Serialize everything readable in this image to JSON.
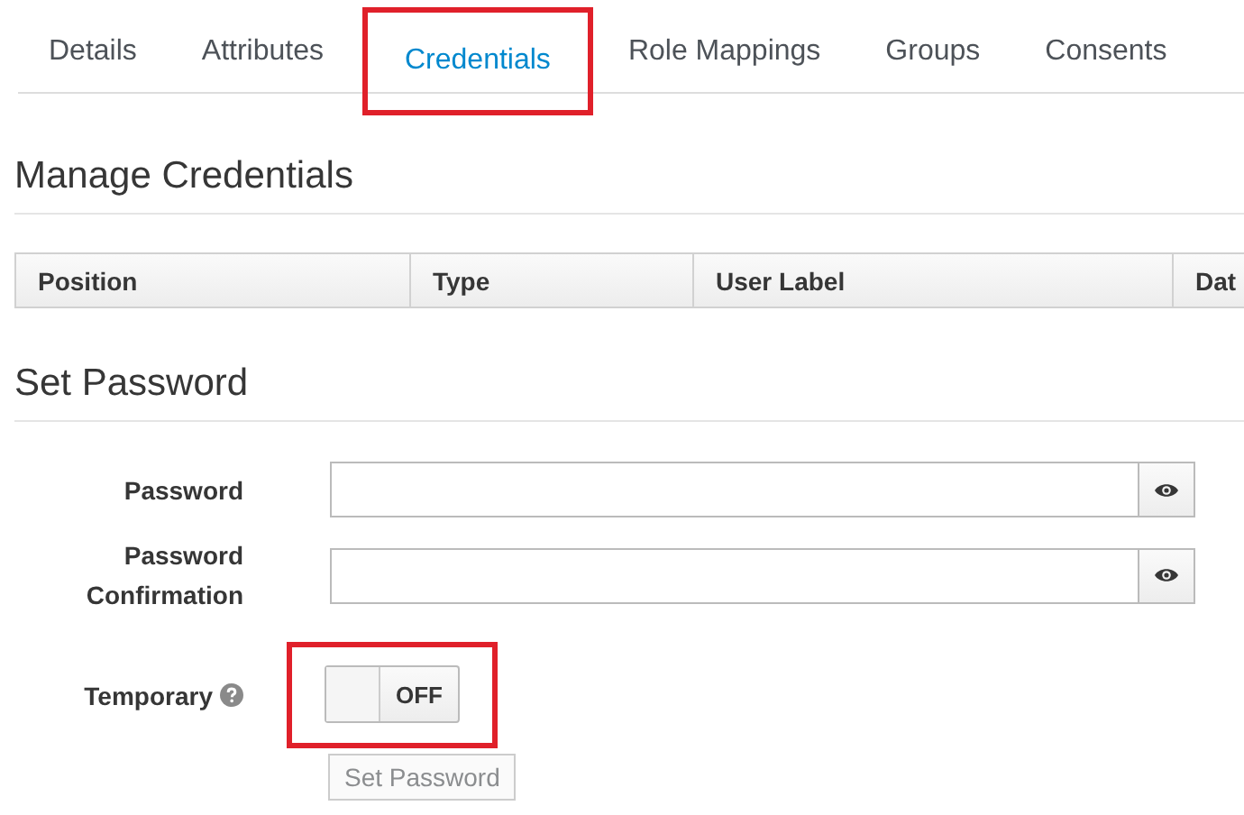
{
  "tabs": [
    {
      "label": "Details",
      "selected": false,
      "highlighted": false
    },
    {
      "label": "Attributes",
      "selected": false,
      "highlighted": false
    },
    {
      "label": "Credentials",
      "selected": true,
      "highlighted": true
    },
    {
      "label": "Role Mappings",
      "selected": false,
      "highlighted": false
    },
    {
      "label": "Groups",
      "selected": false,
      "highlighted": false
    },
    {
      "label": "Consents",
      "selected": false,
      "highlighted": false
    }
  ],
  "manage_credentials": {
    "heading": "Manage Credentials",
    "columns": [
      "Position",
      "Type",
      "User Label",
      "Dat"
    ]
  },
  "set_password": {
    "heading": "Set Password",
    "fields": [
      {
        "label": "Password"
      },
      {
        "label": "Password Confirmation"
      }
    ],
    "temporary": {
      "label": "Temporary",
      "on": false,
      "state_text": "OFF",
      "highlighted": true
    },
    "button": {
      "label": "Set Password",
      "disabled": true
    }
  }
}
